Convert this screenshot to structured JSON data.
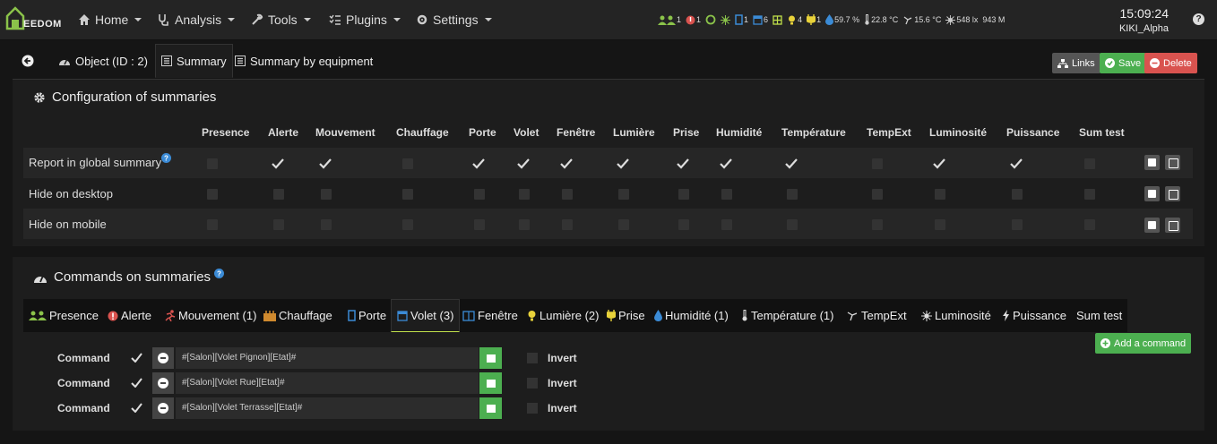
{
  "topbar": {
    "logo_text": "EEDOM",
    "nav": [
      {
        "label": "Home",
        "icon": "home-icon"
      },
      {
        "label": "Analysis",
        "icon": "stethoscope-icon"
      },
      {
        "label": "Tools",
        "icon": "wrench-icon"
      },
      {
        "label": "Plugins",
        "icon": "tasks-icon"
      },
      {
        "label": "Settings",
        "icon": "cogs-icon"
      }
    ],
    "summary": [
      {
        "icon": "presence-icon",
        "value": "1"
      },
      {
        "icon": "alert-icon",
        "value": "1"
      },
      {
        "icon": "motion-ring-icon",
        "value": ""
      },
      {
        "icon": "heating-icon",
        "value": ""
      },
      {
        "icon": "door-icon",
        "value": "1"
      },
      {
        "icon": "shutter-icon",
        "value": "6"
      },
      {
        "icon": "window-icon",
        "value": ""
      },
      {
        "icon": "light-icon",
        "value": "4"
      },
      {
        "icon": "plug-icon",
        "value": "1"
      },
      {
        "icon": "humidity-icon",
        "value": "59.7 %"
      },
      {
        "icon": "thermometer-icon",
        "value": "22.8 °C"
      },
      {
        "icon": "outdoor-temp-icon",
        "value": "15.6 °C"
      },
      {
        "icon": "luminosity-icon",
        "value": "548 lx"
      },
      {
        "icon": "power-icon",
        "value": "943 M"
      }
    ],
    "time": "15:09:24",
    "user": "KIKI_Alpha"
  },
  "tabs": {
    "back": "back-icon",
    "object": "Object (ID : 2)",
    "summary": "Summary",
    "by_equipment": "Summary by equipment"
  },
  "actions": {
    "links": "Links",
    "save": "Save",
    "delete": "Delete"
  },
  "config": {
    "title": "Configuration of summaries",
    "columns": [
      "Presence",
      "Alerte",
      "Mouvement",
      "Chauffage",
      "Porte",
      "Volet",
      "Fenêtre",
      "Lumière",
      "Prise",
      "Humidité",
      "Température",
      "TempExt",
      "Luminosité",
      "Puissance",
      "Sum test"
    ],
    "rows": [
      {
        "label": "Report in global summary",
        "help": true,
        "checked": [
          false,
          true,
          true,
          false,
          true,
          true,
          true,
          true,
          true,
          true,
          true,
          false,
          true,
          true,
          false
        ]
      },
      {
        "label": "Hide on desktop",
        "help": false,
        "checked": [
          false,
          false,
          false,
          false,
          false,
          false,
          false,
          false,
          false,
          false,
          false,
          false,
          false,
          false,
          false
        ]
      },
      {
        "label": "Hide on mobile",
        "help": false,
        "checked": [
          false,
          false,
          false,
          false,
          false,
          false,
          false,
          false,
          false,
          false,
          false,
          false,
          false,
          false,
          false
        ]
      }
    ]
  },
  "commands": {
    "title": "Commands on summaries",
    "tabs": [
      "Presence",
      "Alerte",
      "Mouvement (1)",
      "Chauffage",
      "Porte",
      "Volet (3)",
      "Fenêtre",
      "Lumière (2)",
      "Prise",
      "Humidité (1)",
      "Température (1)",
      "TempExt",
      "Luminosité",
      "Puissance",
      "Sum test"
    ],
    "active_tab": "Volet (3)",
    "add_label": "Add a command",
    "rows": [
      {
        "label": "Command",
        "value": "#[Salon][Volet Pignon][Etat]#",
        "invert": "Invert"
      },
      {
        "label": "Command",
        "value": "#[Salon][Volet Rue][Etat]#",
        "invert": "Invert"
      },
      {
        "label": "Command",
        "value": "#[Salon][Volet Terrasse][Etat]#",
        "invert": "Invert"
      }
    ]
  },
  "colors": {
    "accent": "#c0e04a",
    "save": "#4caf50",
    "delete": "#d9534f",
    "link": "#555555",
    "info": "#3b8bd6"
  }
}
